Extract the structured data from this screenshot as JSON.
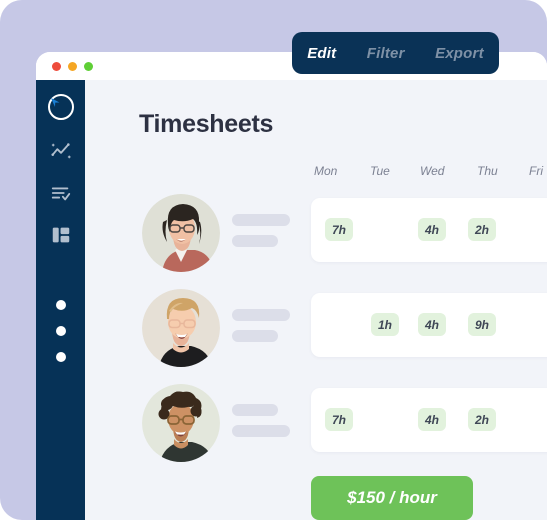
{
  "toolbar": {
    "items": [
      {
        "label": "Edit",
        "state": "active"
      },
      {
        "label": "Filter",
        "state": "muted"
      },
      {
        "label": "Export",
        "state": "muted"
      }
    ]
  },
  "window": {
    "traffic_lights": [
      {
        "name": "close",
        "color": "#ee4c3c"
      },
      {
        "name": "minimize",
        "color": "#f5a623"
      },
      {
        "name": "maximize",
        "color": "#5fcf36"
      }
    ]
  },
  "sidebar": {
    "background": "#063257",
    "logo": "circle-arrow-logo",
    "items": [
      {
        "icon": "analytics-chart-icon"
      },
      {
        "icon": "checklist-icon"
      },
      {
        "icon": "dashboard-grid-icon"
      }
    ],
    "pager_dots": 3
  },
  "main": {
    "title": "Timesheets",
    "day_headers": [
      "Mon",
      "Tue",
      "Wed",
      "Thu",
      "Fri"
    ],
    "rows": [
      {
        "avatar": "avatar-person-glasses-rust-jacket",
        "name_bar_widths": [
          58,
          46
        ],
        "hours": [
          "7h",
          "",
          "4h",
          "2h",
          ""
        ]
      },
      {
        "avatar": "avatar-person-blond-glasses-black-tee",
        "name_bar_widths": [
          58,
          46
        ],
        "hours": [
          "",
          "1h",
          "4h",
          "9h",
          ""
        ]
      },
      {
        "avatar": "avatar-person-curly-hair-glasses",
        "name_bar_widths": [
          46,
          58
        ],
        "hours": [
          "7h",
          "",
          "4h",
          "2h",
          ""
        ]
      }
    ],
    "rate_button": "$150 / hour"
  },
  "colors": {
    "backdrop": "#c6c8e6",
    "sidebar": "#063257",
    "toolbar": "#0a3256",
    "content": "#f2f4f9",
    "pill": "#e2f2dd",
    "accent_green": "#6ec259",
    "title": "#2d3142"
  }
}
